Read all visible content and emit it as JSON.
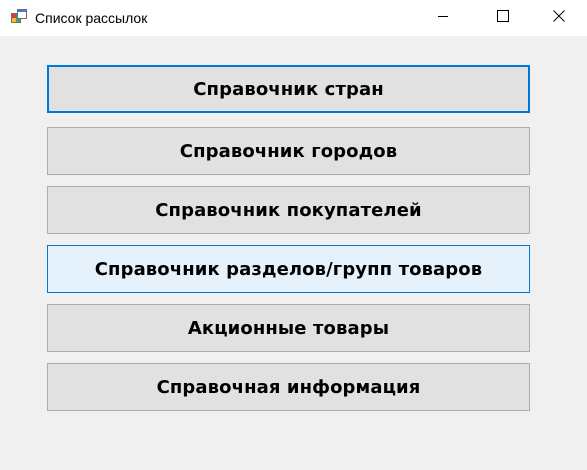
{
  "window": {
    "title": "Список рассылок",
    "icon": "app-window-icon",
    "caption_buttons": [
      "minimize-icon",
      "maximize-icon",
      "close-icon"
    ]
  },
  "menu": {
    "items": [
      {
        "label": "Справочник стран",
        "state": "focused"
      },
      {
        "label": "Справочник городов",
        "state": "normal"
      },
      {
        "label": "Справочник покупателей",
        "state": "normal"
      },
      {
        "label": "Справочник разделов/групп товаров",
        "state": "hovered"
      },
      {
        "label": "Акционные товары",
        "state": "normal"
      },
      {
        "label": "Справочная информация",
        "state": "normal"
      }
    ]
  },
  "colors": {
    "window_bg": "#f0f0f0",
    "titlebar_bg": "#ffffff",
    "button_bg": "#e1e1e1",
    "button_border": "#adadad",
    "accent": "#0078d7",
    "hover_bg": "#e5f1fb"
  }
}
